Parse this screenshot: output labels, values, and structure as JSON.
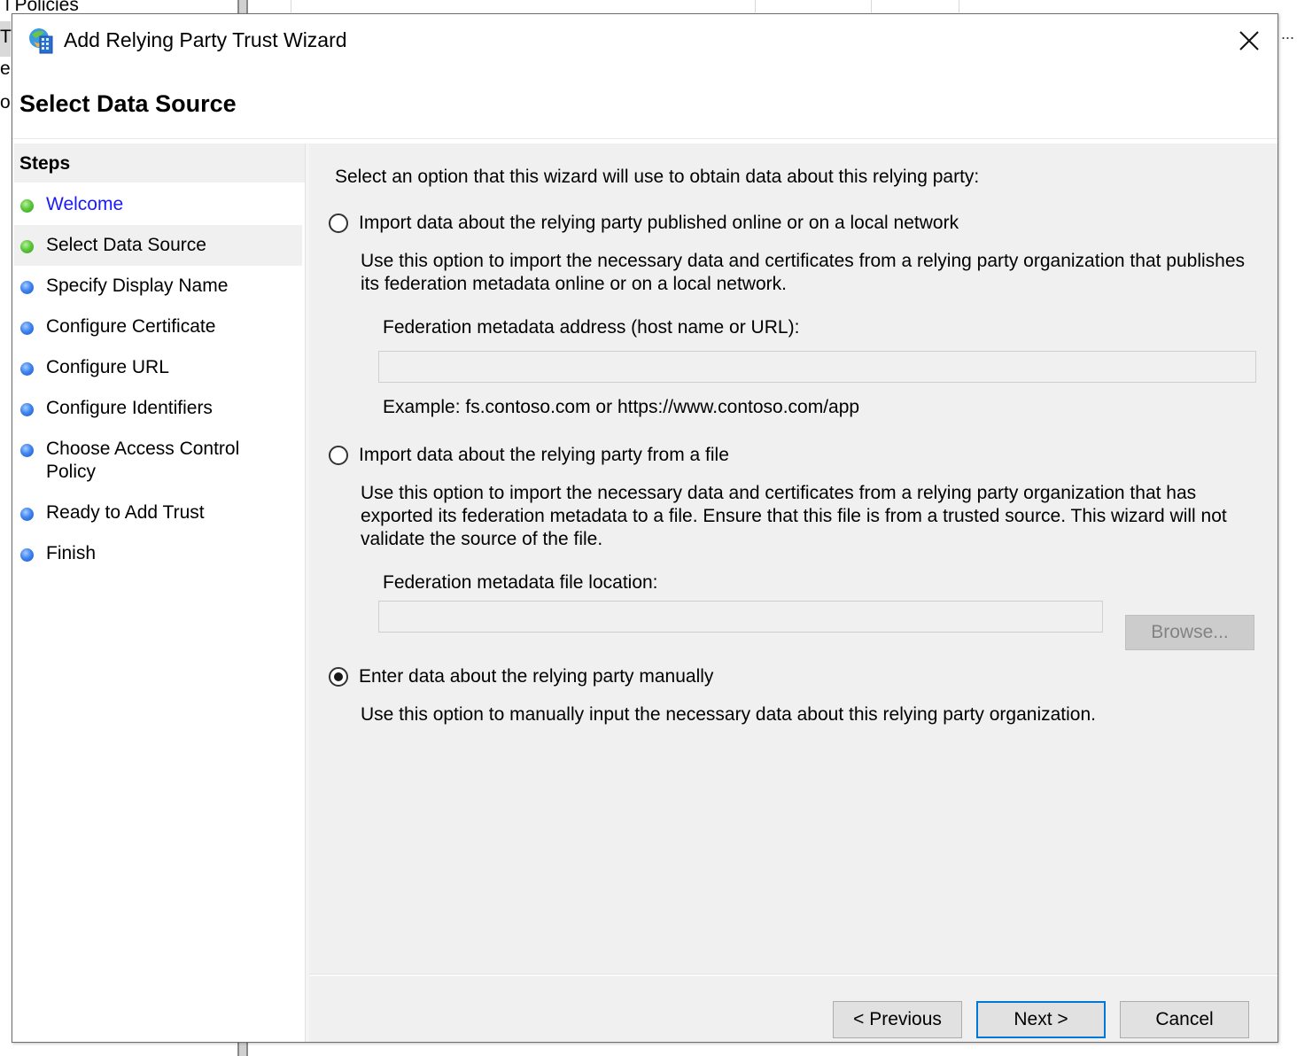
{
  "background": {
    "policies_fragment": "l Policies",
    "left_fragments": [
      "Tr",
      "er",
      "o"
    ],
    "ellipsis": "..."
  },
  "dialog": {
    "title": "Add Relying Party Trust Wizard",
    "app_icon": "adfs-wizard-icon",
    "close_icon": "close-icon",
    "page_header": "Select Data Source"
  },
  "steps": {
    "header": "Steps",
    "items": [
      {
        "label": "Welcome",
        "status": "completed",
        "is_link": true
      },
      {
        "label": "Select Data Source",
        "status": "current",
        "is_link": false
      },
      {
        "label": "Specify Display Name",
        "status": "pending",
        "is_link": false
      },
      {
        "label": "Configure Certificate",
        "status": "pending",
        "is_link": false
      },
      {
        "label": "Configure URL",
        "status": "pending",
        "is_link": false
      },
      {
        "label": "Configure Identifiers",
        "status": "pending",
        "is_link": false
      },
      {
        "label": "Choose Access Control Policy",
        "status": "pending",
        "is_link": false
      },
      {
        "label": "Ready to Add Trust",
        "status": "pending",
        "is_link": false
      },
      {
        "label": "Finish",
        "status": "pending",
        "is_link": false
      }
    ],
    "colors": {
      "completed": "#5cc83a",
      "pending": "#3f86f0",
      "link": "#1a1aff"
    }
  },
  "content": {
    "intro": "Select an option that this wizard will use to obtain data about this relying party:",
    "options": [
      {
        "label": "Import data about the relying party published online or on a local network",
        "checked": false,
        "description": "Use this option to import the necessary data and certificates from a relying party organization that publishes its federation metadata online or on a local network.",
        "field_label": "Federation metadata address (host name or URL):",
        "field_value": "",
        "example": "Example: fs.contoso.com or https://www.contoso.com/app"
      },
      {
        "label": "Import data about the relying party from a file",
        "checked": false,
        "description": "Use this option to import the necessary data and certificates from a relying party organization that has exported its federation metadata to a file. Ensure that this file is from a trusted source.  This wizard will not validate the source of the file.",
        "field_label": "Federation metadata file location:",
        "field_value": "",
        "browse_label": "Browse..."
      },
      {
        "label": "Enter data about the relying party manually",
        "checked": true,
        "description": "Use this option to manually input the necessary data about this relying party organization."
      }
    ]
  },
  "footer": {
    "previous_label": "< Previous",
    "next_label": "Next >",
    "cancel_label": "Cancel",
    "default_button_color": "#0078d7"
  }
}
